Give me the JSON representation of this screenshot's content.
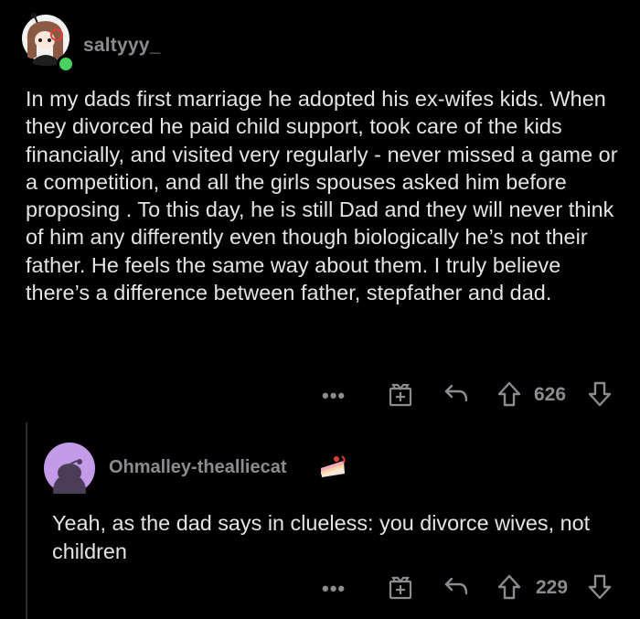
{
  "comment1": {
    "username": "saltyyy_",
    "body": "In my dads first marriage he adopted his ex-wifes kids. When they divorced he paid child support, took care of the kids financially, and visited very regularly - never missed a game or a competition, and all the girls spouses asked him before proposing . To this day, he is still Dad and they will never think of him any differently even though biologically he’s not their father. He feels the same way about them. I truly believe there’s a difference between father, stepfather and dad.",
    "more_label": "•••",
    "vote_count": "626",
    "icons": [
      "avatar-icon",
      "online-status-icon",
      "more-icon",
      "award-icon",
      "reply-icon",
      "upvote-icon",
      "downvote-icon"
    ]
  },
  "comment2": {
    "username": "Ohmalley-thealliecat",
    "body": "Yeah, as the dad says in clueless: you divorce wives, not children",
    "more_label": "•••",
    "vote_count": "229",
    "icons": [
      "avatar-icon",
      "cake-day-icon",
      "more-icon",
      "award-icon",
      "reply-icon",
      "upvote-icon",
      "downvote-icon"
    ]
  },
  "colors": {
    "background": "#000000",
    "text": "#e3e4e6",
    "muted": "#8a8c8f",
    "online": "#46d160",
    "avatar2_bg": "#c39be8"
  }
}
